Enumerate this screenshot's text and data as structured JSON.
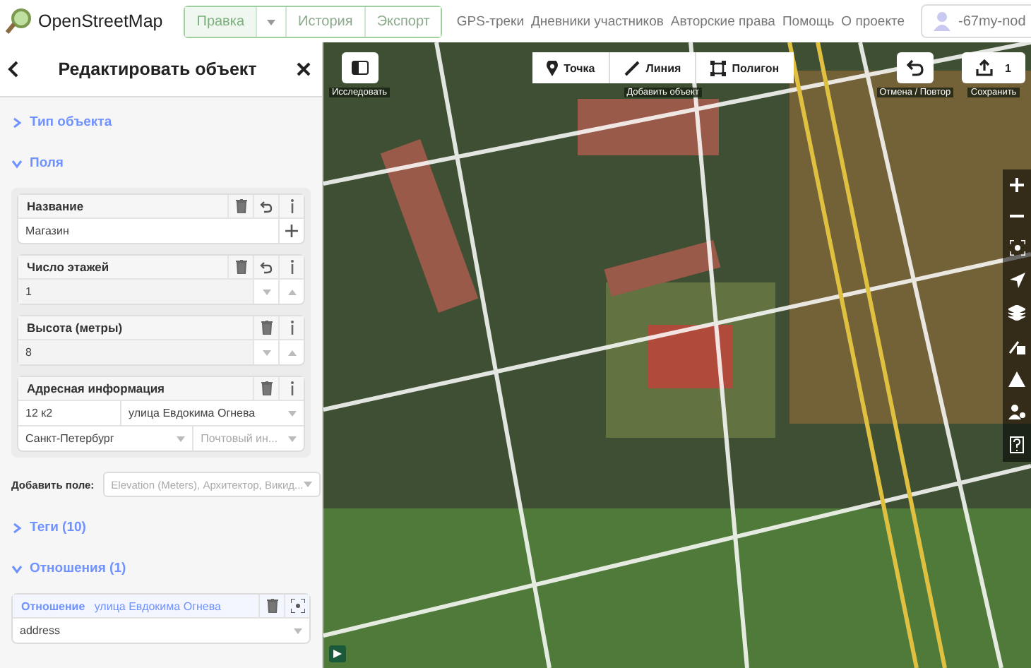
{
  "topbar": {
    "logo": "OpenStreetMap",
    "tabs": [
      {
        "label": "Правка",
        "selected": true,
        "kind": "tab"
      },
      {
        "selected": false,
        "kind": "caret"
      },
      {
        "label": "История",
        "selected": false,
        "kind": "tab"
      },
      {
        "label": "Экспорт",
        "selected": false,
        "kind": "tab"
      }
    ],
    "links": [
      "GPS-треки",
      "Дневники участников",
      "Авторские права",
      "Помощь",
      "О проекте"
    ],
    "user": "-67my-nod"
  },
  "sidebar": {
    "title": "Редактировать объект",
    "sections": [
      {
        "title": "Тип объекта",
        "expanded": false,
        "kind": "preset"
      },
      {
        "title": "Поля",
        "expanded": true,
        "kind": "fields"
      },
      {
        "title": "Теги (10)",
        "expanded": false,
        "kind": "tags"
      },
      {
        "title": "Отношения (1)",
        "expanded": true,
        "kind": "relations"
      }
    ],
    "fields": [
      {
        "label": "Название",
        "kind": "text",
        "value": "Магазин",
        "changed": true
      },
      {
        "label": "Число этажей",
        "kind": "number",
        "value": "1",
        "changed": true
      },
      {
        "label": "Высота (метры)",
        "kind": "number",
        "value": "8",
        "changed": false
      },
      {
        "label": "Адресная информация",
        "kind": "address",
        "housenumber": "12 к2",
        "street": "улица Евдокима Огнева",
        "city": "Санкт-Петербург",
        "postcode_placeholder": "Почтовый ин...",
        "changed": false
      }
    ],
    "add_field": {
      "label": "Добавить поле:",
      "placeholder": "Elevation (Meters), Архитектор, Викид..."
    },
    "relation": {
      "label": "Отношение",
      "name": "улица Евдокима Огнева",
      "role": "address"
    }
  },
  "map": {
    "explore_label": "Исследовать",
    "add_buttons": [
      {
        "label": "Точка",
        "kind": "point"
      },
      {
        "label": "Линия",
        "kind": "line"
      },
      {
        "label": "Полигон",
        "kind": "area"
      }
    ],
    "add_label": "Добавить объект",
    "undo_label": "Отмена / Повтор",
    "save_count": "1",
    "save_label": "Сохранить"
  }
}
